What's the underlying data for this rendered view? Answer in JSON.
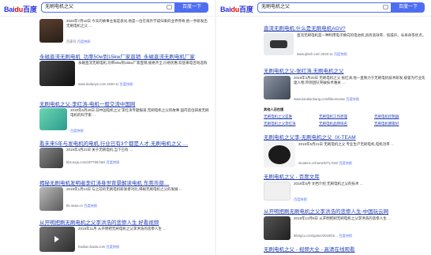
{
  "search": {
    "logo_a": "Bai",
    "logo_b": "du",
    "logo_cn": "百度",
    "query": "无刷电机之父",
    "button": "百度一下"
  },
  "left": {
    "r0": {
      "txt": "2020年7月18日 今天的故事主角是袁光,他是一位在海外学成归来的业界传奇,他一手研发出 无刷电机之父 …",
      "src": "百家号",
      "action": "百度快照"
    },
    "r1": {
      "title": "永磁直流无刷电机_功率50w到15kw厂家直销_永磁直流无刷电机厂家",
      "txt": "永磁直流无刷电机,功率50w到15kw厂家直销,规格齐全,价格优惠,欢迎来电咨询选购",
      "src": "www.dedaoye.com 2020-11",
      "action": "百度快照"
    },
    "r2": {
      "title": "无刷电机之父·李红涛-电机一般交流中国网",
      "txt": "2019年6月26日 前中国电机之父 李红涛专题报道,无刷电机之父的故事 国内首位研发无刷电机的科学家 …",
      "action": "百度快照"
    },
    "r3": {
      "title": "看未来5年与发电机的电机,行业已有3个都是人才,无刷电机之父 …",
      "txt": "2019年4月21日 关于无刷电机,当下已有 …",
      "src": "bbs.tuqu.com/267759.html",
      "action": "百度快照"
    },
    "r4": {
      "title": "揭秘无刷电机发明者李红涛身世背景解读电机 东莞市部…",
      "txt": "2019年1月13日 与之前的无刷电机研发者对比,揭秘无刷电机之父的发展 …",
      "src": "bk.news.cn",
      "action": "百度快照"
    },
    "r5": {
      "title": "从开明把刷无刷电机之父李洪浩的悲惨人生 好看视频",
      "txt": "2019年11月 从开明把无刷电机之父李洪浩的悲惨人生 …",
      "src": "haokan.baidu.com",
      "action": "百度快照"
    }
  },
  "right": {
    "r0": {
      "title": "直流无刷电机,什么是无刷电机AGV?",
      "txt": "直流无刷电机是一种利用电子换向的电动机,具有高效率、低噪声、长寿命等优点。",
      "src": "www.qbrch.com 2020-11",
      "action": "百度快照"
    },
    "r1": {
      "title": "无刷电机之父-张红涛,无刷电机之父",
      "txt": "2019年3月20日 无刷电机之父 张红涛,他一直致力于无刷电机技术研发,被誉为行业先驱人物,带领团队突破技术难关 …",
      "src": "www.kandianhang.com/litleoreview",
      "action": "百度快照"
    },
    "related": {
      "label": "其他人还在搜",
      "items": [
        "无刷电机之父是谁",
        "无刷电机工作原理",
        "无刷电机控制器",
        "无刷电机之父李红涛",
        "无刷电机品牌排名",
        "无刷电机哪家好"
      ]
    },
    "r2": {
      "title": "无刷电机之父李-无刷电机之父_IX-TEAM",
      "txt": "2019年5月21日 无刷电机之父 专业生产无刷电机,电机功率 …",
      "src": "vtuotenc.cnhome/DTL.html",
      "action": "百度快照"
    },
    "r3": {
      "title": "无刷电机之父 - 百度文库",
      "txt": "2019年6月 文档介绍 无刷电机之父的技术 …",
      "src": "wenku.baidu.com",
      "action": "百度快照"
    },
    "r4": {
      "title": "从开明把刷无刷电机之父李洪浩的悲惨人生-中国玩云网",
      "txt": "2019年12月8日 从开明把刷无刷电机之父李洪浩的悲惨人生 …",
      "src": "5fengcu.com/game/2019/02…",
      "action": "百度快照"
    },
    "r5": {
      "title": "无刷电机之父 - 视频大全 - 高清在线观看",
      "txt": ""
    }
  }
}
